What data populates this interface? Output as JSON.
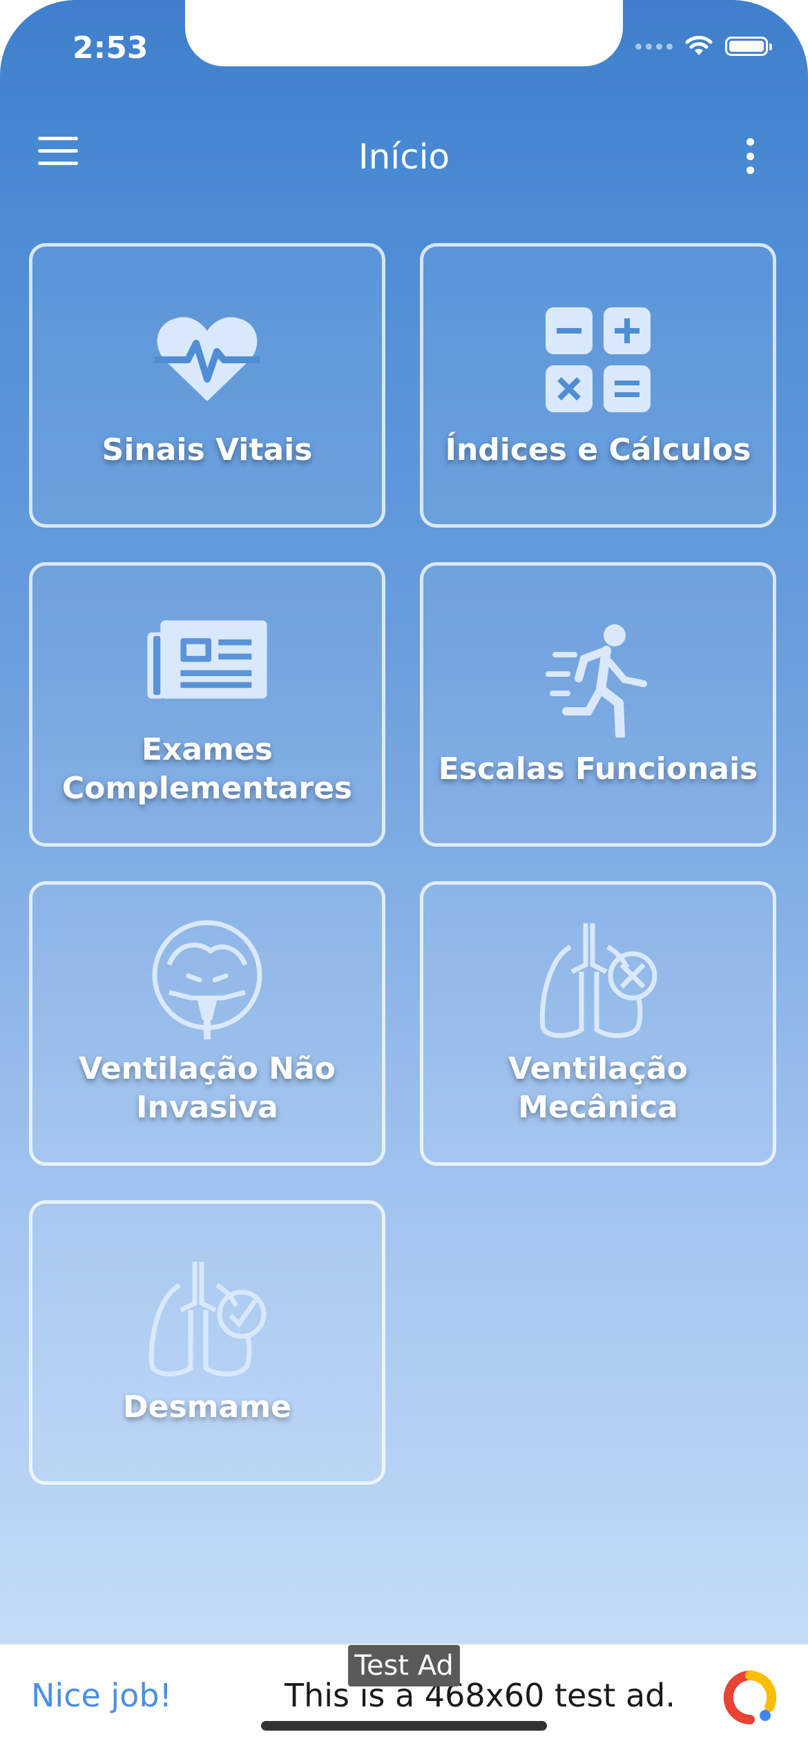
{
  "status_bar": {
    "time": "2:53"
  },
  "appbar": {
    "title": "Início"
  },
  "cards": [
    {
      "label": "Sinais Vitais",
      "icon": "heartbeat-icon"
    },
    {
      "label": "Índices e Cálculos",
      "icon": "calculator-icon"
    },
    {
      "label": "Exames Complementares",
      "icon": "newspaper-icon"
    },
    {
      "label": "Escalas Funcionais",
      "icon": "running-person-icon"
    },
    {
      "label": "Ventilação Não Invasiva",
      "icon": "oxygen-mask-icon"
    },
    {
      "label": "Ventilação Mecânica",
      "icon": "lungs-x-icon"
    },
    {
      "label": "Desmame",
      "icon": "lungs-check-icon"
    }
  ],
  "ad": {
    "tag": "Test Ad",
    "headline": "Nice job!",
    "body": "This is a 468x60 test ad."
  },
  "colors": {
    "gradient_top": "#3f7fcb",
    "gradient_bottom": "#c3dcf8",
    "icon_fill": "#d9e8fb",
    "ad_link": "#4a8fe3"
  }
}
